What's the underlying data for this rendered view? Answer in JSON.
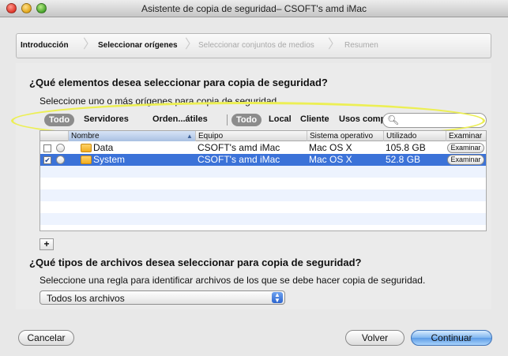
{
  "window": {
    "title": "Asistente de copia de seguridad– CSOFT's amd iMac"
  },
  "steps": [
    {
      "label": "Introducción",
      "state": "done"
    },
    {
      "label": "Seleccionar orígenes",
      "state": "current"
    },
    {
      "label": "Seleccionar conjuntos de medios",
      "state": "disabled"
    },
    {
      "label": "Resumen",
      "state": "disabled"
    }
  ],
  "section1": {
    "heading": "¿Qué elementos desea seleccionar para copia de seguridad?",
    "subheading": "Seleccione uno o más orígenes para copia de seguridad."
  },
  "filters": {
    "group1": [
      "Todo",
      "Servidores",
      "Orden...átiles"
    ],
    "group2": [
      "Todo",
      "Local",
      "Cliente",
      "Usos compartidos"
    ],
    "search_placeholder": ""
  },
  "table": {
    "columns": [
      "Nombre",
      "Equipo",
      "Sistema operativo",
      "Utilizado",
      "Examinar"
    ],
    "rows": [
      {
        "nombre": "Data",
        "equipo": "CSOFT's amd iMac",
        "so": "Mac OS X",
        "utilizado": "105.8 GB",
        "action": "Examinar",
        "checked": false,
        "selected": false
      },
      {
        "nombre": "System",
        "equipo": "CSOFT's amd iMac",
        "so": "Mac OS X",
        "utilizado": "52.8 GB",
        "action": "Examinar",
        "checked": true,
        "selected": true
      }
    ],
    "add_label": "+"
  },
  "section2": {
    "heading": "¿Qué tipos de archivos desea seleccionar para copia de seguridad?",
    "subheading": "Seleccione una regla para identificar archivos de los que se debe hacer copia de seguridad.",
    "rule_selected": "Todos los archivos"
  },
  "buttons": {
    "cancel": "Cancelar",
    "back": "Volver",
    "continue": "Continuar"
  },
  "colors": {
    "selection": "#3b72d8",
    "highlight_annotation": "#ecef54"
  }
}
